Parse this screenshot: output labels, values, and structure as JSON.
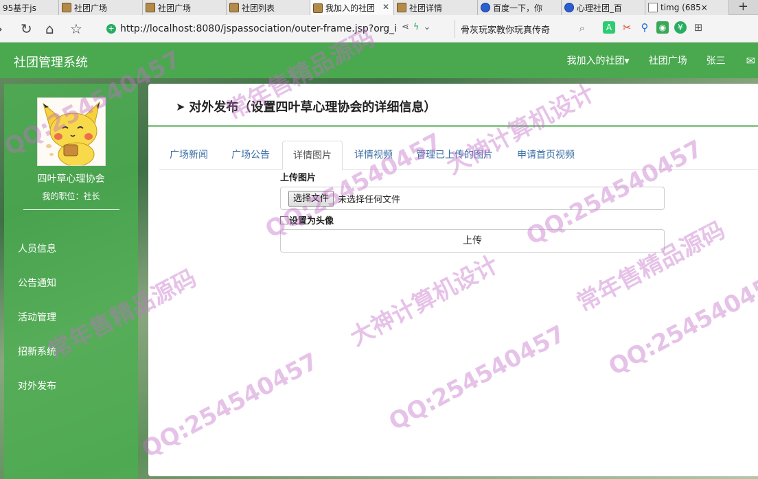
{
  "browser": {
    "tabs": [
      {
        "label": "95基于js",
        "icon": "partial-tab"
      },
      {
        "label": "社团广场",
        "icon": "pikachu-favicon-icon"
      },
      {
        "label": "社团广场",
        "icon": "pikachu-favicon-icon"
      },
      {
        "label": "社团列表",
        "icon": "pikachu-favicon-icon"
      },
      {
        "label": "我加入的社团",
        "icon": "pikachu-favicon-icon",
        "active": true
      },
      {
        "label": "社团详情",
        "icon": "pikachu-favicon-icon"
      },
      {
        "label": "百度一下，你",
        "icon": "baidu-paw-icon"
      },
      {
        "label": "心理社团_百",
        "icon": "baidu-paw-icon"
      },
      {
        "label": "timg (685×",
        "icon": "document-icon"
      }
    ],
    "new_tab": "+",
    "url": "http://localhost:8080/jspassociation/outer-frame.jsp?org_i",
    "search_text": "骨灰玩家教你玩真传奇"
  },
  "app": {
    "brand": "社团管理系统",
    "nav": {
      "my_clubs": "我加入的社团▾",
      "square": "社团广场",
      "user": "张三",
      "mail_icon": "envelope-icon"
    },
    "sidebar": {
      "org_name": "四叶草心理协会",
      "role": "我的职位：社长",
      "menu": [
        "人员信息",
        "公告通知",
        "活动管理",
        "招新系统",
        "对外发布"
      ]
    },
    "panel": {
      "title": "对外发布（设置四叶草心理协会的详细信息）",
      "tabs": [
        "广场新闻",
        "广场公告",
        "详情图片",
        "详情视频",
        "管理已上传的图片",
        "申请首页视频"
      ],
      "active_tab": "详情图片",
      "upload_label": "上传图片",
      "file_button": "选择文件",
      "file_status": "未选择任何文件",
      "checkbox_label": "设置为头像",
      "checkbox_checked": false,
      "submit_label": "上传"
    }
  },
  "watermark": {
    "lines": [
      "QQ:254540457",
      "常年售精品源码",
      "大神计算机设计"
    ]
  },
  "colors": {
    "navbar": "#4aa84f",
    "sidebar": "#4caf50",
    "panel_line": "#8ec98f",
    "tab_link": "#3b6ea5"
  }
}
